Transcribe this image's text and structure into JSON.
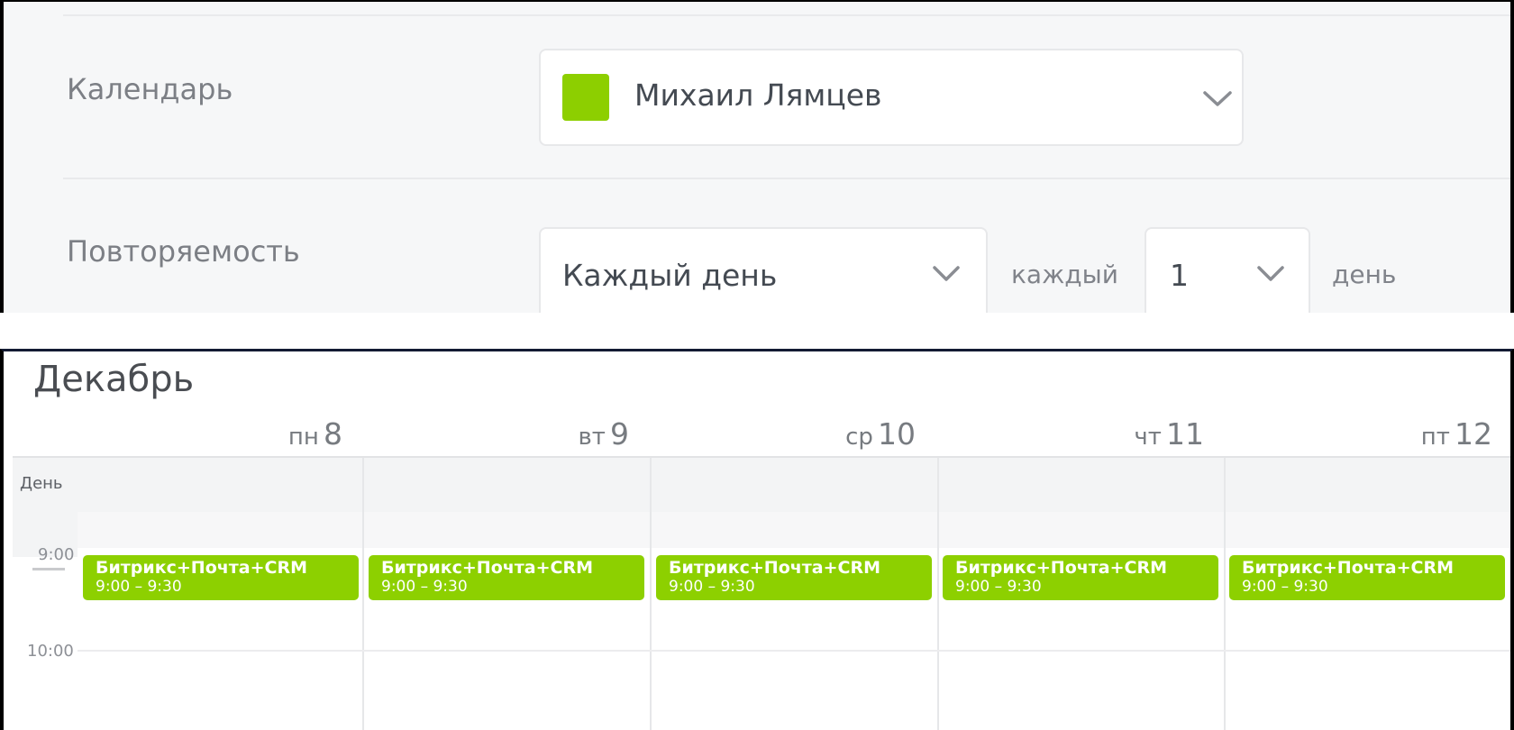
{
  "form": {
    "calendar": {
      "label": "Календарь",
      "value": "Михаил Лямцев",
      "color": "#8dcf00"
    },
    "repeat": {
      "label": "Повторяемость",
      "frequency": "Каждый день",
      "every_label": "каждый",
      "interval": "1",
      "unit": "день"
    }
  },
  "calendar": {
    "month": "Декабрь",
    "days": [
      {
        "dow": "пн",
        "dom": "8"
      },
      {
        "dow": "вт",
        "dom": "9"
      },
      {
        "dow": "ср",
        "dom": "10"
      },
      {
        "dow": "чт",
        "dom": "11"
      },
      {
        "dow": "пт",
        "dom": "12"
      }
    ],
    "allday_label": "День",
    "times": [
      "9:00",
      "10:00"
    ],
    "event_color": "#8dd000",
    "events": [
      {
        "title": "Битрикс+Почта+CRM",
        "time": "9:00 – 9:30"
      },
      {
        "title": "Битрикс+Почта+CRM",
        "time": "9:00 – 9:30"
      },
      {
        "title": "Битрикс+Почта+CRM",
        "time": "9:00 – 9:30"
      },
      {
        "title": "Битрикс+Почта+CRM",
        "time": "9:00 – 9:30"
      },
      {
        "title": "Битрикс+Почта+CRM",
        "time": "9:00 – 9:30"
      }
    ]
  }
}
